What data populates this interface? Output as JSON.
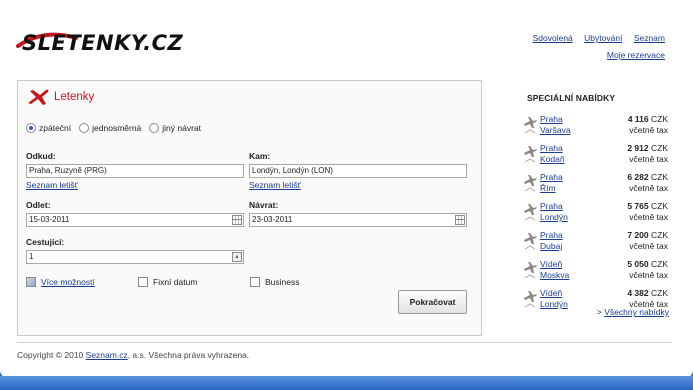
{
  "header": {
    "logo_text": "SLETENKY.CZ",
    "links": [
      "Sdovolená",
      "Ubytování",
      "Seznam"
    ],
    "reservations": "Moje rezervace"
  },
  "form": {
    "title": "Letenky",
    "trip_types": [
      {
        "label": "zpáteční",
        "selected": true
      },
      {
        "label": "jednosměrná",
        "selected": false
      },
      {
        "label": "jiný návrat",
        "selected": false
      }
    ],
    "from": {
      "label": "Odkud:",
      "value": "Praha, Ruzyně (PRG)",
      "link": "Seznam letišť"
    },
    "to": {
      "label": "Kam:",
      "value": "Londýn, Londýn (LON)",
      "link": "Seznam letišť"
    },
    "depart": {
      "label": "Odlet:",
      "value": "15-03-2011"
    },
    "return": {
      "label": "Návrat:",
      "value": "23-03-2011"
    },
    "passengers": {
      "label": "Cestující:",
      "value": "1"
    },
    "more_options": "Více možností",
    "fixed_date": "Fixní datum",
    "business": "Business",
    "submit": "Pokračovat"
  },
  "offers": {
    "title": "SPECIÁLNÍ NABÍDKY",
    "items": [
      {
        "from": "Praha",
        "to": "Varšava",
        "price": "4 116",
        "currency": "CZK",
        "tax": "včetně tax"
      },
      {
        "from": "Praha",
        "to": "Kodaň",
        "price": "2 912",
        "currency": "CZK",
        "tax": "včetně tax"
      },
      {
        "from": "Praha",
        "to": "Řím",
        "price": "6 282",
        "currency": "CZK",
        "tax": "včetně tax"
      },
      {
        "from": "Praha",
        "to": "Londýn",
        "price": "5 765",
        "currency": "CZK",
        "tax": "včetně tax"
      },
      {
        "from": "Praha",
        "to": "Dubaj",
        "price": "7 200",
        "currency": "CZK",
        "tax": "včetně tax"
      },
      {
        "from": "Vídeň",
        "to": "Moskva",
        "price": "5 050",
        "currency": "CZK",
        "tax": "včetně tax"
      },
      {
        "from": "Vídeň",
        "to": "Londýn",
        "price": "4 382",
        "currency": "CZK",
        "tax": "včetně tax"
      }
    ],
    "all_prefix": ">",
    "all_link": "Všechny nabídky"
  },
  "footer": {
    "prefix": "Copyright © 2010",
    "link": "Seznam.cz",
    "suffix": ", a.s. Všechna práva vyhrazena."
  },
  "colors": {
    "brand_red": "#c8161d",
    "link_blue": "#1a3d8f",
    "background_blue": "#2a6fc9"
  }
}
